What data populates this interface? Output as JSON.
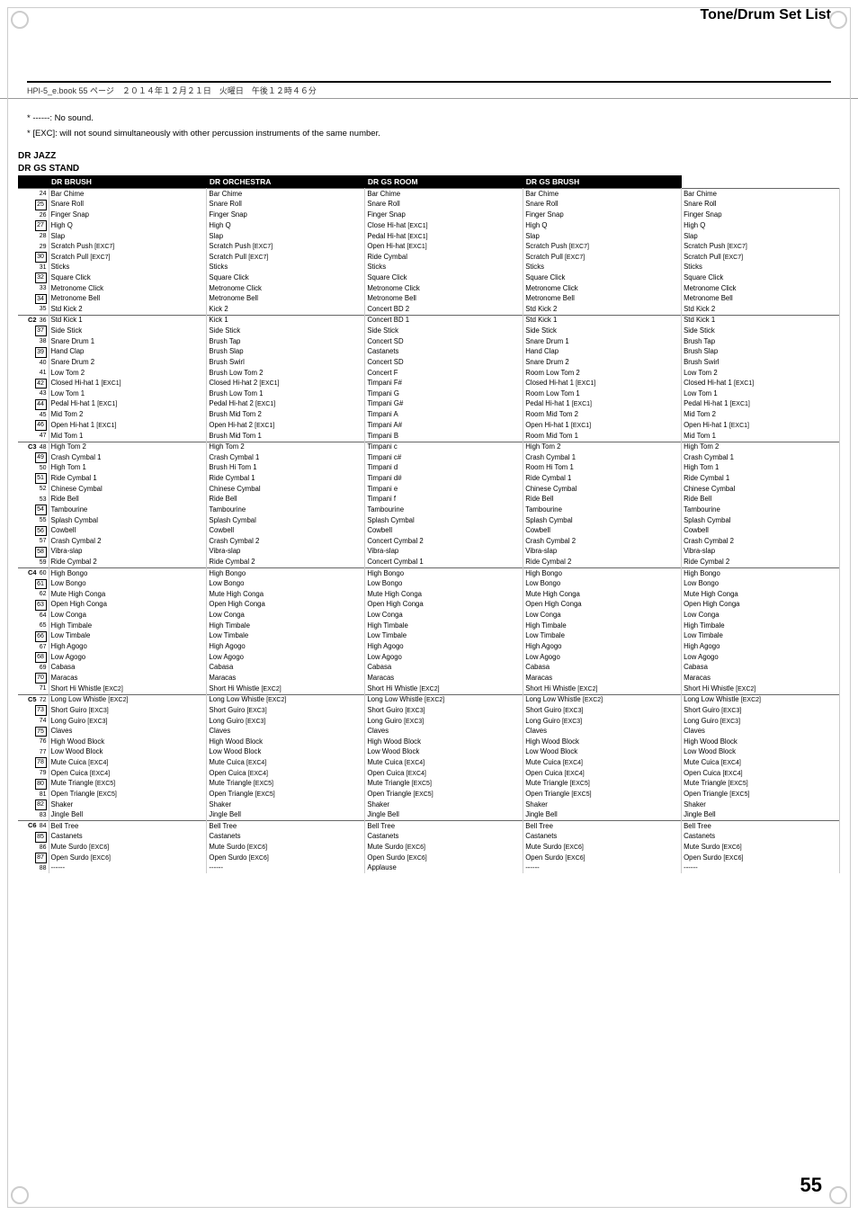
{
  "page": {
    "title": "Tone/Drum Set List",
    "header_meta": "HPI-5_e.book  55 ページ　２０１４年１２月２１日　火曜日　午後１２時４６分",
    "page_number": "55",
    "notes": [
      "* ------: No sound.",
      "* [EXC]: will not sound simultaneously with other percussion instruments of the same number."
    ]
  },
  "table": {
    "section_title_1": "DR JAZZ",
    "section_title_2": "DR GS STAND",
    "columns": [
      {
        "id": "num",
        "label": ""
      },
      {
        "id": "dr_jazz",
        "label": "DR BRUSH"
      },
      {
        "id": "dr_orchestra",
        "label": "DR ORCHESTRA"
      },
      {
        "id": "dr_gs_room",
        "label": "DR GS ROOM"
      },
      {
        "id": "dr_gs_brush",
        "label": "DR GS BRUSH"
      }
    ],
    "rows": [
      {
        "num": "24",
        "box": false,
        "section": "",
        "jazz": "Bar Chime",
        "brush": "Bar Chime",
        "orch": "Bar Chime",
        "room": "Bar Chime",
        "gbrush": "Bar Chime"
      },
      {
        "num": "25",
        "box": true,
        "section": "",
        "jazz": "Snare Roll",
        "brush": "Snare Roll",
        "orch": "Snare Roll",
        "room": "Snare Roll",
        "gbrush": "Snare Roll"
      },
      {
        "num": "26",
        "box": false,
        "section": "",
        "jazz": "Finger Snap",
        "brush": "Finger Snap",
        "orch": "Finger Snap",
        "room": "Finger Snap",
        "gbrush": "Finger Snap"
      },
      {
        "num": "27",
        "box": true,
        "section": "",
        "jazz": "High Q",
        "brush": "High Q",
        "orch": "Close Hi-hat [EXC1]",
        "room": "High Q",
        "gbrush": "High Q"
      },
      {
        "num": "28",
        "box": false,
        "section": "",
        "jazz": "Slap",
        "brush": "Slap",
        "orch": "Pedal Hi-hat [EXC1]",
        "room": "Slap",
        "gbrush": "Slap"
      },
      {
        "num": "29",
        "box": false,
        "section": "",
        "jazz": "Scratch Push [EXC7]",
        "brush": "Scratch Push [EXC7]",
        "orch": "Open Hi-hat [EXC1]",
        "room": "Scratch Push [EXC7]",
        "gbrush": "Scratch Push [EXC7]"
      },
      {
        "num": "30",
        "box": true,
        "section": "",
        "jazz": "Scratch Pull [EXC7]",
        "brush": "Scratch Pull [EXC7]",
        "orch": "Ride Cymbal",
        "room": "Scratch Pull [EXC7]",
        "gbrush": "Scratch Pull [EXC7]"
      },
      {
        "num": "31",
        "box": false,
        "section": "",
        "jazz": "Sticks",
        "brush": "Sticks",
        "orch": "Sticks",
        "room": "Sticks",
        "gbrush": "Sticks"
      },
      {
        "num": "32",
        "box": true,
        "section": "",
        "jazz": "Square Click",
        "brush": "Square Click",
        "orch": "Square Click",
        "room": "Square Click",
        "gbrush": "Square Click"
      },
      {
        "num": "33",
        "box": false,
        "section": "",
        "jazz": "Metronome Click",
        "brush": "Metronome Click",
        "orch": "Metronome Click",
        "room": "Metronome Click",
        "gbrush": "Metronome Click"
      },
      {
        "num": "34",
        "box": true,
        "section": "",
        "jazz": "Metronome Bell",
        "brush": "Metronome Bell",
        "orch": "Metronome Bell",
        "room": "Metronome Bell",
        "gbrush": "Metronome Bell"
      },
      {
        "num": "35",
        "box": false,
        "section": "",
        "jazz": "Std Kick 2",
        "brush": "Kick 2",
        "orch": "Concert BD 2",
        "room": "Std Kick 2",
        "gbrush": "Std Kick 2"
      },
      {
        "num": "C2 36",
        "box": false,
        "section": "C2",
        "jazz": "Std Kick 1",
        "brush": "Kick 1",
        "orch": "Concert BD 1",
        "room": "Std Kick 1",
        "gbrush": "Std Kick 1"
      },
      {
        "num": "37",
        "box": true,
        "section": "",
        "jazz": "Side Stick",
        "brush": "Side Stick",
        "orch": "Side Stick",
        "room": "Side Stick",
        "gbrush": "Side Stick"
      },
      {
        "num": "38",
        "box": false,
        "section": "",
        "jazz": "Snare Drum 1",
        "brush": "Brush Tap",
        "orch": "Concert SD",
        "room": "Snare Drum 1",
        "gbrush": "Brush Tap"
      },
      {
        "num": "39",
        "box": true,
        "section": "",
        "jazz": "Hand Clap",
        "brush": "Brush Slap",
        "orch": "Castanets",
        "room": "Hand Clap",
        "gbrush": "Brush Slap"
      },
      {
        "num": "40",
        "box": false,
        "section": "",
        "jazz": "Snare Drum 2",
        "brush": "Brush Swirl",
        "orch": "Concert SD",
        "room": "Snare Drum 2",
        "gbrush": "Brush Swirl"
      },
      {
        "num": "41",
        "box": false,
        "section": "",
        "jazz": "Low Tom 2",
        "brush": "Brush Low Tom 2",
        "orch": "Concert F",
        "room": "Room Low Tom 2",
        "gbrush": "Low Tom 2"
      },
      {
        "num": "42",
        "box": true,
        "section": "",
        "jazz": "Closed Hi-hat 1 [EXC1]",
        "brush": "Closed Hi-hat 2 [EXC1]",
        "orch": "Timpani F#",
        "room": "Closed Hi-hat 1 [EXC1]",
        "gbrush": "Closed Hi-hat 1 [EXC1]"
      },
      {
        "num": "43",
        "box": false,
        "section": "",
        "jazz": "Low Tom 1",
        "brush": "Brush Low Tom 1",
        "orch": "Timpani G",
        "room": "Room Low Tom 1",
        "gbrush": "Low Tom 1"
      },
      {
        "num": "44",
        "box": true,
        "section": "",
        "jazz": "Pedal Hi-hat 1 [EXC1]",
        "brush": "Pedal Hi-hat 2 [EXC1]",
        "orch": "Timpani G#",
        "room": "Pedal Hi-hat 1 [EXC1]",
        "gbrush": "Pedal Hi-hat 1 [EXC1]"
      },
      {
        "num": "45",
        "box": false,
        "section": "",
        "jazz": "Mid Tom 2",
        "brush": "Brush Mid Tom 2",
        "orch": "Timpani A",
        "room": "Room Mid Tom 2",
        "gbrush": "Mid Tom 2"
      },
      {
        "num": "46",
        "box": true,
        "section": "",
        "jazz": "Open Hi-hat 1 [EXC1]",
        "brush": "Open Hi-hat 2 [EXC1]",
        "orch": "Timpani A#",
        "room": "Open Hi-hat 1 [EXC1]",
        "gbrush": "Open Hi-hat 1 [EXC1]"
      },
      {
        "num": "47",
        "box": false,
        "section": "",
        "jazz": "Mid Tom 1",
        "brush": "Brush Mid Tom 1",
        "orch": "Timpani B",
        "room": "Room Mid Tom 1",
        "gbrush": "Mid Tom 1"
      },
      {
        "num": "C3 48",
        "box": false,
        "section": "C3",
        "jazz": "High Tom 2",
        "brush": "High Tom 2",
        "orch": "Timpani c",
        "room": "High Tom 2",
        "gbrush": "High Tom 2"
      },
      {
        "num": "49",
        "box": true,
        "section": "",
        "jazz": "Crash Cymbal 1",
        "brush": "Crash Cymbal 1",
        "orch": "Timpani c#",
        "room": "Crash Cymbal 1",
        "gbrush": "Crash Cymbal 1"
      },
      {
        "num": "50",
        "box": false,
        "section": "",
        "jazz": "High Tom 1",
        "brush": "Brush Hi Tom 1",
        "orch": "Timpani d",
        "room": "Room Hi Tom 1",
        "gbrush": "High Tom 1"
      },
      {
        "num": "51",
        "box": true,
        "section": "",
        "jazz": "Ride Cymbal 1",
        "brush": "Ride Cymbal 1",
        "orch": "Timpani d#",
        "room": "Ride Cymbal 1",
        "gbrush": "Ride Cymbal 1"
      },
      {
        "num": "52",
        "box": false,
        "section": "",
        "jazz": "Chinese Cymbal",
        "brush": "Chinese Cymbal",
        "orch": "Timpani e",
        "room": "Chinese Cymbal",
        "gbrush": "Chinese Cymbal"
      },
      {
        "num": "53",
        "box": false,
        "section": "",
        "jazz": "Ride Bell",
        "brush": "Ride Bell",
        "orch": "Timpani f",
        "room": "Ride Bell",
        "gbrush": "Ride Bell"
      },
      {
        "num": "54",
        "box": true,
        "section": "",
        "jazz": "Tambourine",
        "brush": "Tambourine",
        "orch": "Tambourine",
        "room": "Tambourine",
        "gbrush": "Tambourine"
      },
      {
        "num": "55",
        "box": false,
        "section": "",
        "jazz": "Splash Cymbal",
        "brush": "Splash Cymbal",
        "orch": "Splash Cymbal",
        "room": "Splash Cymbal",
        "gbrush": "Splash Cymbal"
      },
      {
        "num": "56",
        "box": true,
        "section": "",
        "jazz": "Cowbell",
        "brush": "Cowbell",
        "orch": "Cowbell",
        "room": "Cowbell",
        "gbrush": "Cowbell"
      },
      {
        "num": "57",
        "box": false,
        "section": "",
        "jazz": "Crash Cymbal 2",
        "brush": "Crash Cymbal 2",
        "orch": "Concert Cymbal 2",
        "room": "Crash Cymbal 2",
        "gbrush": "Crash Cymbal 2"
      },
      {
        "num": "58",
        "box": true,
        "section": "",
        "jazz": "Vibra-slap",
        "brush": "Vibra-slap",
        "orch": "Vibra-slap",
        "room": "Vibra-slap",
        "gbrush": "Vibra-slap"
      },
      {
        "num": "59",
        "box": false,
        "section": "",
        "jazz": "Ride Cymbal 2",
        "brush": "Ride Cymbal 2",
        "orch": "Concert Cymbal 1",
        "room": "Ride Cymbal 2",
        "gbrush": "Ride Cymbal 2"
      },
      {
        "num": "C4 60",
        "box": false,
        "section": "C4",
        "jazz": "High Bongo",
        "brush": "High Bongo",
        "orch": "High Bongo",
        "room": "High Bongo",
        "gbrush": "High Bongo"
      },
      {
        "num": "61",
        "box": true,
        "section": "",
        "jazz": "Low Bongo",
        "brush": "Low Bongo",
        "orch": "Low Bongo",
        "room": "Low Bongo",
        "gbrush": "Low Bongo"
      },
      {
        "num": "62",
        "box": false,
        "section": "",
        "jazz": "Mute High Conga",
        "brush": "Mute High Conga",
        "orch": "Mute High Conga",
        "room": "Mute High Conga",
        "gbrush": "Mute High Conga"
      },
      {
        "num": "63",
        "box": true,
        "section": "",
        "jazz": "Open High Conga",
        "brush": "Open High Conga",
        "orch": "Open High Conga",
        "room": "Open High Conga",
        "gbrush": "Open High Conga"
      },
      {
        "num": "64",
        "box": false,
        "section": "",
        "jazz": "Low Conga",
        "brush": "Low Conga",
        "orch": "Low Conga",
        "room": "Low Conga",
        "gbrush": "Low Conga"
      },
      {
        "num": "65",
        "box": false,
        "section": "",
        "jazz": "High Timbale",
        "brush": "High Timbale",
        "orch": "High Timbale",
        "room": "High Timbale",
        "gbrush": "High Timbale"
      },
      {
        "num": "66",
        "box": true,
        "section": "",
        "jazz": "Low Timbale",
        "brush": "Low Timbale",
        "orch": "Low Timbale",
        "room": "Low Timbale",
        "gbrush": "Low Timbale"
      },
      {
        "num": "67",
        "box": false,
        "section": "",
        "jazz": "High Agogo",
        "brush": "High Agogo",
        "orch": "High Agogo",
        "room": "High Agogo",
        "gbrush": "High Agogo"
      },
      {
        "num": "68",
        "box": true,
        "section": "",
        "jazz": "Low Agogo",
        "brush": "Low Agogo",
        "orch": "Low Agogo",
        "room": "Low Agogo",
        "gbrush": "Low Agogo"
      },
      {
        "num": "69",
        "box": false,
        "section": "",
        "jazz": "Cabasa",
        "brush": "Cabasa",
        "orch": "Cabasa",
        "room": "Cabasa",
        "gbrush": "Cabasa"
      },
      {
        "num": "70",
        "box": true,
        "section": "",
        "jazz": "Maracas",
        "brush": "Maracas",
        "orch": "Maracas",
        "room": "Maracas",
        "gbrush": "Maracas"
      },
      {
        "num": "71",
        "box": false,
        "section": "",
        "jazz": "Short Hi Whistle [EXC2]",
        "brush": "Short Hi Whistle [EXC2]",
        "orch": "Short Hi Whistle [EXC2]",
        "room": "Short Hi Whistle [EXC2]",
        "gbrush": "Short Hi Whistle [EXC2]"
      },
      {
        "num": "C5 72",
        "box": false,
        "section": "C5",
        "jazz": "Long Low Whistle [EXC2]",
        "brush": "Long Low Whistle [EXC2]",
        "orch": "Long Low Whistle [EXC2]",
        "room": "Long Low Whistle [EXC2]",
        "gbrush": "Long Low Whistle [EXC2]"
      },
      {
        "num": "73",
        "box": true,
        "section": "",
        "jazz": "Short Guiro [EXC3]",
        "brush": "Short Guiro [EXC3]",
        "orch": "Short Guiro [EXC3]",
        "room": "Short Guiro [EXC3]",
        "gbrush": "Short Guiro [EXC3]"
      },
      {
        "num": "74",
        "box": false,
        "section": "",
        "jazz": "Long Guiro [EXC3]",
        "brush": "Long Guiro [EXC3]",
        "orch": "Long Guiro [EXC3]",
        "room": "Long Guiro [EXC3]",
        "gbrush": "Long Guiro [EXC3]"
      },
      {
        "num": "75",
        "box": true,
        "section": "",
        "jazz": "Claves",
        "brush": "Claves",
        "orch": "Claves",
        "room": "Claves",
        "gbrush": "Claves"
      },
      {
        "num": "76",
        "box": false,
        "section": "",
        "jazz": "High Wood Block",
        "brush": "High Wood Block",
        "orch": "High Wood Block",
        "room": "High Wood Block",
        "gbrush": "High Wood Block"
      },
      {
        "num": "77",
        "box": false,
        "section": "",
        "jazz": "Low Wood Block",
        "brush": "Low Wood Block",
        "orch": "Low Wood Block",
        "room": "Low Wood Block",
        "gbrush": "Low Wood Block"
      },
      {
        "num": "78",
        "box": true,
        "section": "",
        "jazz": "Mute Cuica [EXC4]",
        "brush": "Mute Cuica [EXC4]",
        "orch": "Mute Cuica [EXC4]",
        "room": "Mute Cuica [EXC4]",
        "gbrush": "Mute Cuica [EXC4]"
      },
      {
        "num": "79",
        "box": false,
        "section": "",
        "jazz": "Open Cuica [EXC4]",
        "brush": "Open Cuica [EXC4]",
        "orch": "Open Cuica [EXC4]",
        "room": "Open Cuica [EXC4]",
        "gbrush": "Open Cuica [EXC4]"
      },
      {
        "num": "80",
        "box": true,
        "section": "",
        "jazz": "Mute Triangle [EXC5]",
        "brush": "Mute Triangle [EXC5]",
        "orch": "Mute Triangle [EXC5]",
        "room": "Mute Triangle [EXC5]",
        "gbrush": "Mute Triangle [EXC5]"
      },
      {
        "num": "81",
        "box": false,
        "section": "",
        "jazz": "Open Triangle [EXC5]",
        "brush": "Open Triangle [EXC5]",
        "orch": "Open Triangle [EXC5]",
        "room": "Open Triangle [EXC5]",
        "gbrush": "Open Triangle [EXC5]"
      },
      {
        "num": "82",
        "box": true,
        "section": "",
        "jazz": "Shaker",
        "brush": "Shaker",
        "orch": "Shaker",
        "room": "Shaker",
        "gbrush": "Shaker"
      },
      {
        "num": "83",
        "box": false,
        "section": "",
        "jazz": "Jingle Bell",
        "brush": "Jingle Bell",
        "orch": "Jingle Bell",
        "room": "Jingle Bell",
        "gbrush": "Jingle Bell"
      },
      {
        "num": "C6 84",
        "box": false,
        "section": "C6",
        "jazz": "Bell Tree",
        "brush": "Bell Tree",
        "orch": "Bell Tree",
        "room": "Bell Tree",
        "gbrush": "Bell Tree"
      },
      {
        "num": "85",
        "box": true,
        "section": "",
        "jazz": "Castanets",
        "brush": "Castanets",
        "orch": "Castanets",
        "room": "Castanets",
        "gbrush": "Castanets"
      },
      {
        "num": "86",
        "box": false,
        "section": "",
        "jazz": "Mute Surdo [EXC6]",
        "brush": "Mute Surdo [EXC6]",
        "orch": "Mute Surdo [EXC6]",
        "room": "Mute Surdo [EXC6]",
        "gbrush": "Mute Surdo [EXC6]"
      },
      {
        "num": "87",
        "box": true,
        "section": "",
        "jazz": "Open Surdo [EXC6]",
        "brush": "Open Surdo [EXC6]",
        "orch": "Open Surdo [EXC6]",
        "room": "Open Surdo [EXC6]",
        "gbrush": "Open Surdo [EXC6]"
      },
      {
        "num": "88",
        "box": false,
        "section": "",
        "jazz": "------",
        "brush": "------",
        "orch": "Applause",
        "room": "------",
        "gbrush": "------"
      }
    ]
  }
}
